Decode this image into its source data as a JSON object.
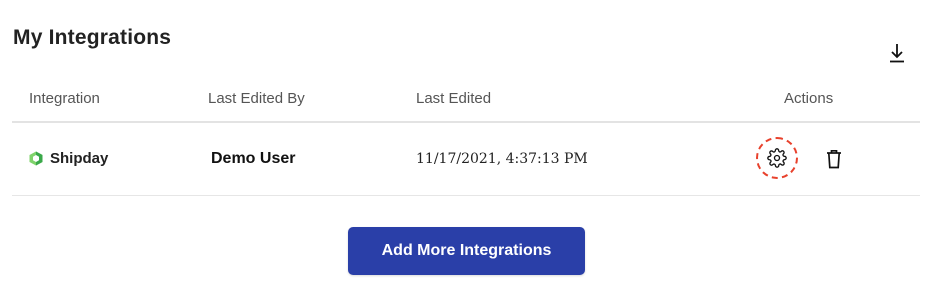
{
  "page": {
    "title": "My Integrations"
  },
  "icons": {
    "download": "download-icon",
    "integration": "hexagon-logo-icon",
    "settings": "gear-icon",
    "delete": "trash-icon"
  },
  "colors": {
    "accent": "#2a3fa8",
    "highlight_ring": "#e8412c",
    "logo_green": "#5cc24e"
  },
  "table": {
    "headers": {
      "integration": "Integration",
      "last_edited_by": "Last Edited By",
      "last_edited": "Last Edited",
      "actions": "Actions"
    },
    "rows": [
      {
        "integration": "Shipday",
        "last_edited_by": "Demo User",
        "last_edited": "11/17/2021, 4:37:13 PM"
      }
    ]
  },
  "buttons": {
    "add_more": "Add More Integrations"
  }
}
